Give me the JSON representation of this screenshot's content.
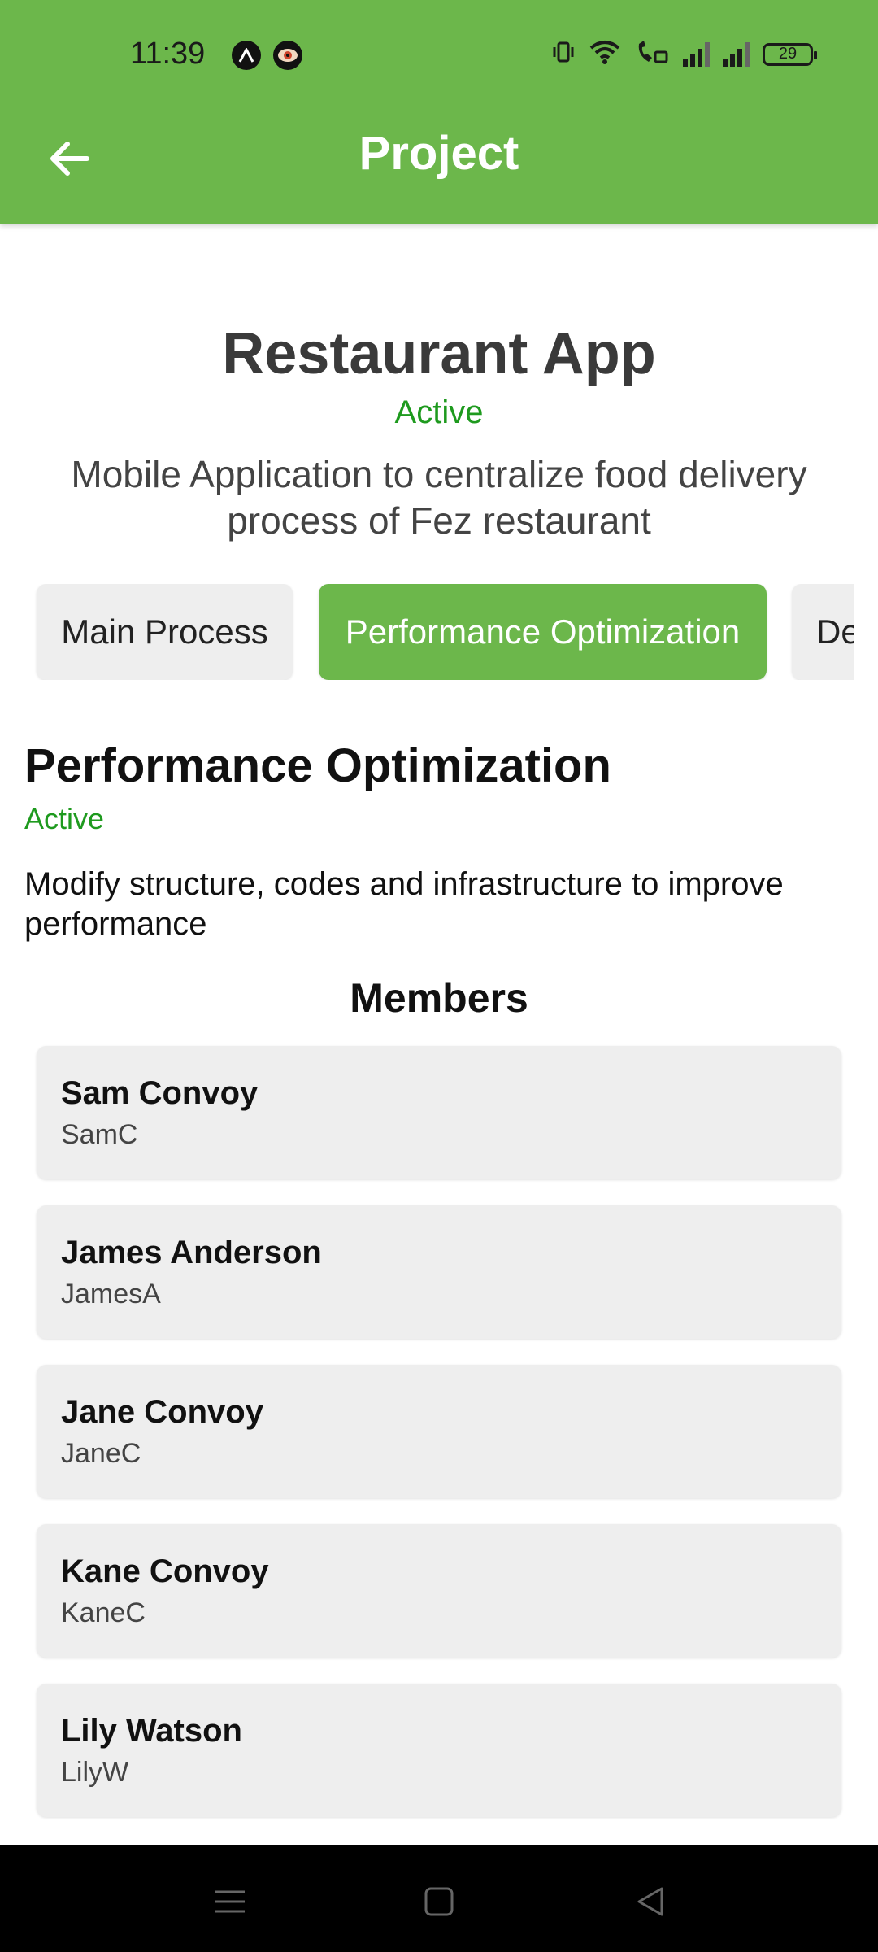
{
  "status_bar": {
    "time": "11:39",
    "left_icons": [
      "arrow-a-icon",
      "eye-icon"
    ],
    "right_icons": [
      "vibrate-icon",
      "wifi-icon",
      "wifi-call-icon",
      "signal-icon",
      "signal-icon"
    ],
    "battery": "29"
  },
  "app_bar": {
    "title": "Project",
    "back_icon": "arrow-left-icon",
    "color": "#6cb74b"
  },
  "project": {
    "name": "Restaurant App",
    "status": "Active",
    "description": "Mobile Application to centralize food delivery process of Fez restaurant"
  },
  "tabs": [
    {
      "label": "Main Process",
      "active": false
    },
    {
      "label": "Performance Optimization",
      "active": true
    },
    {
      "label": "De",
      "active": false
    }
  ],
  "section": {
    "title": "Performance Optimization",
    "status": "Active",
    "description": "Modify structure, codes and infrastructure to improve performance",
    "status_color": "#1e9a1e"
  },
  "members": {
    "title": "Members",
    "items": [
      {
        "name": "Sam Convoy",
        "username": "SamC"
      },
      {
        "name": "James Anderson",
        "username": "JamesA"
      },
      {
        "name": "Jane Convoy",
        "username": "JaneC"
      },
      {
        "name": "Kane Convoy",
        "username": "KaneC"
      },
      {
        "name": "Lily Watson",
        "username": "LilyW"
      }
    ]
  },
  "nav_bar": {
    "icons": [
      "menu-icon",
      "home-square-icon",
      "back-triangle-icon"
    ]
  }
}
